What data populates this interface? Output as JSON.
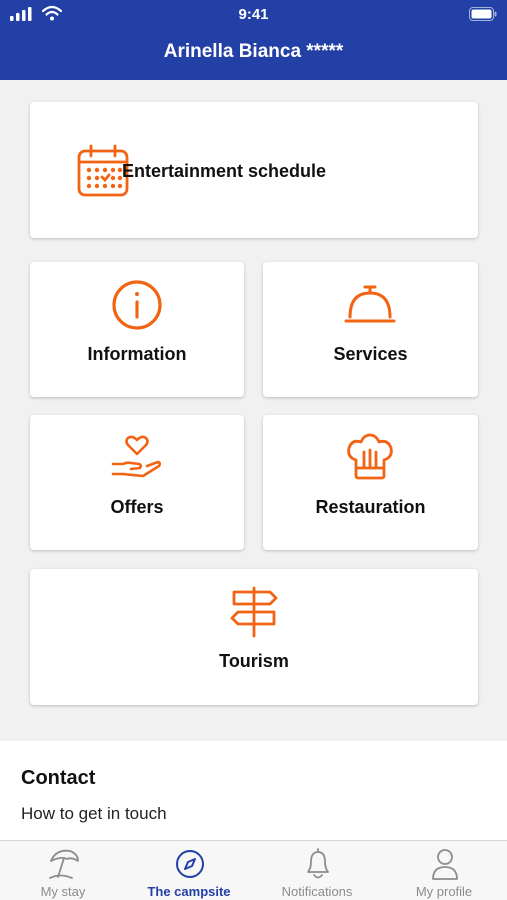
{
  "status": {
    "time": "9:41"
  },
  "header": {
    "title": "Arinella Bianca *****"
  },
  "colors": {
    "brand": "#2340a6",
    "accent": "#f06414"
  },
  "cards": {
    "entertainment": {
      "label": "Entertainment schedule",
      "icon": "calendar-icon"
    },
    "information": {
      "label": "Information",
      "icon": "info-icon"
    },
    "services": {
      "label": "Services",
      "icon": "service-bell-icon"
    },
    "offers": {
      "label": "Offers",
      "icon": "heart-hand-icon"
    },
    "restauration": {
      "label": "Restauration",
      "icon": "chef-hat-icon"
    },
    "tourism": {
      "label": "Tourism",
      "icon": "signpost-icon"
    }
  },
  "contact": {
    "heading": "Contact",
    "subtitle": "How to get in touch"
  },
  "tabs": [
    {
      "label": "My stay",
      "icon": "beach-umbrella-icon",
      "active": false
    },
    {
      "label": "The campsite",
      "icon": "compass-icon",
      "active": true
    },
    {
      "label": "Notifications",
      "icon": "bell-icon",
      "active": false
    },
    {
      "label": "My profile",
      "icon": "user-icon",
      "active": false
    }
  ]
}
